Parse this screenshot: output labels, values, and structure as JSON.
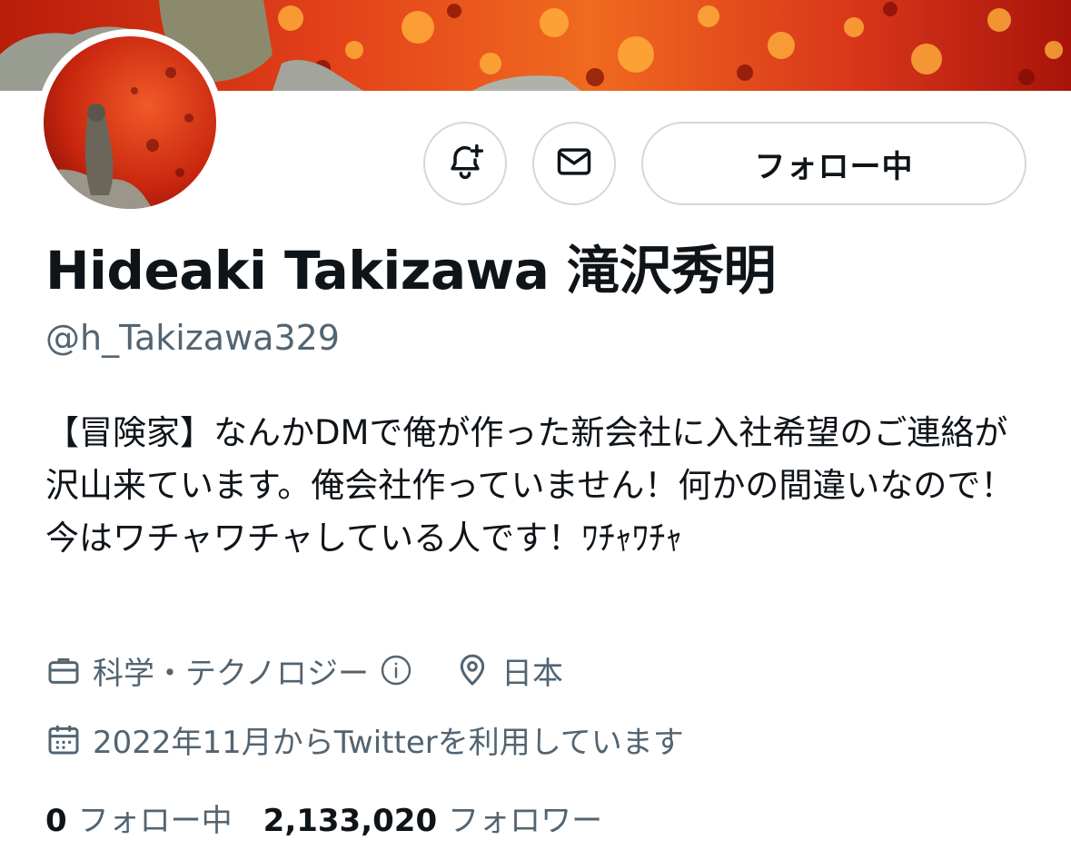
{
  "profile": {
    "display_name": "Hideaki Takizawa 滝沢秀明",
    "handle": "@h_Takizawa329",
    "bio": "【冒険家】なんかDMで俺が作った新会社に入社希望のご連絡が沢山来ています。俺会社作っていません！何かの間違いなので！今はワチャワチャしている人です！ﾜﾁｬﾜﾁｬ",
    "category": "科学・テクノロジー",
    "location": "日本",
    "joined": "2022年11月からTwitterを利用しています"
  },
  "actions": {
    "follow_label": "フォロー中"
  },
  "stats": {
    "following_count": "0",
    "following_label": "フォロー中",
    "followers_count": "2,133,020",
    "followers_label": "フォロワー"
  },
  "icons": {
    "notify": "bell-plus-icon",
    "message": "envelope-icon",
    "category": "briefcase-icon",
    "category_info": "info-icon",
    "location": "location-pin-icon",
    "joined": "calendar-icon"
  },
  "colors": {
    "text_primary": "#0f1419",
    "text_secondary": "#536471",
    "border": "#cfd9de",
    "banner_base": "#c82a10"
  }
}
